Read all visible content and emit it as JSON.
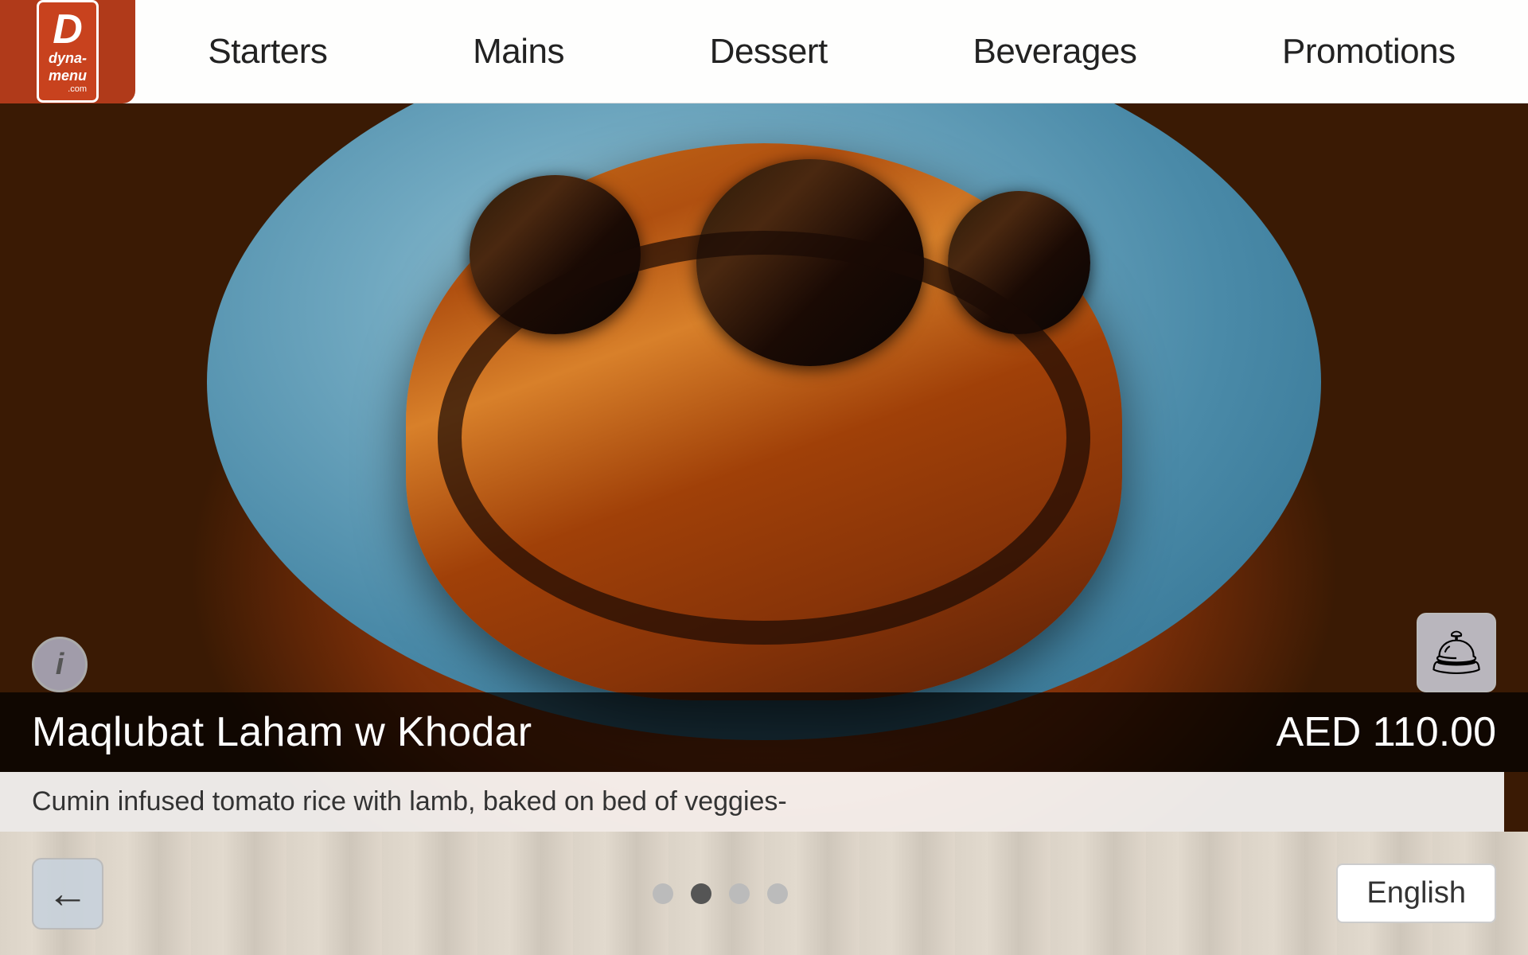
{
  "app": {
    "name": "dyna-menu",
    "logo_line1": "dyna-",
    "logo_line2": "menu",
    "logo_com": ".com"
  },
  "nav": {
    "items": [
      {
        "id": "starters",
        "label": "Starters"
      },
      {
        "id": "mains",
        "label": "Mains"
      },
      {
        "id": "dessert",
        "label": "Dessert"
      },
      {
        "id": "beverages",
        "label": "Beverages"
      },
      {
        "id": "promotions",
        "label": "Promotions"
      }
    ]
  },
  "dish": {
    "name": "Maqlubat Laham w Khodar",
    "price": "AED 110.00",
    "description": "Cumin infused tomato rice with lamb, baked on bed of veggies-"
  },
  "carousel": {
    "total_dots": 4,
    "active_dot": 1
  },
  "footer": {
    "back_label": "←",
    "language_label": "English"
  },
  "icons": {
    "info": "ℹ",
    "order": "🛎",
    "back": "←"
  }
}
